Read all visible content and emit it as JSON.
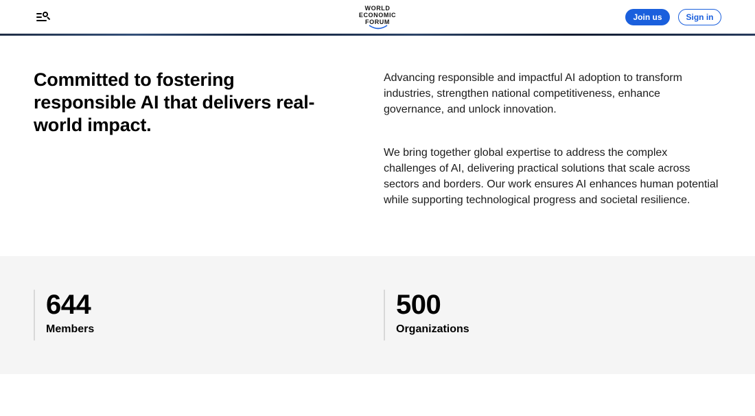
{
  "header": {
    "logo_lines": [
      "WORLD",
      "ECONOMIC",
      "FORUM"
    ],
    "join_label": "Join us",
    "sign_in_label": "Sign in",
    "accent_color": "#1a5fdd"
  },
  "intro": {
    "headline": "Committed to fostering responsible AI that delivers real-world impact.",
    "paragraphs": [
      "Advancing responsible and impactful AI adoption to transform industries, strengthen national competitiveness, enhance governance, and unlock innovation.",
      "We bring together global expertise to address the complex challenges of AI, delivering practical solutions that scale across sectors and borders. Our work ensures AI enhances human potential while supporting technological progress and societal resilience."
    ]
  },
  "stats": [
    {
      "value": "644",
      "label": "Members"
    },
    {
      "value": "500",
      "label": "Organizations"
    }
  ],
  "icons": {
    "menu": "menu-search-icon",
    "logo_arc": "logo-arc-icon"
  }
}
